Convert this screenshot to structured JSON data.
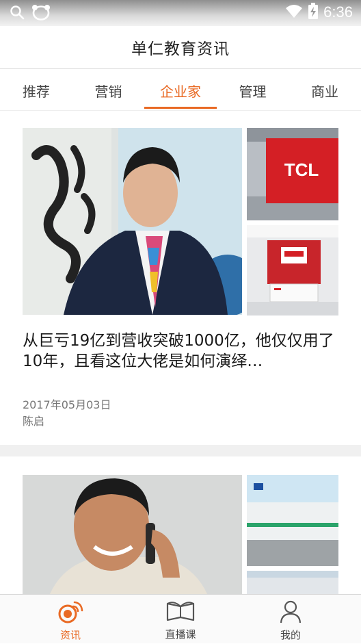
{
  "status_bar": {
    "time": "6:36"
  },
  "app": {
    "title": "单仁教育资讯"
  },
  "tabs": [
    {
      "label": "推荐"
    },
    {
      "label": "营销"
    },
    {
      "label": "企业家"
    },
    {
      "label": "管理"
    },
    {
      "label": "商业"
    }
  ],
  "active_tab": "企业家",
  "articles": [
    {
      "title": "从巨亏19亿到营收突破1000亿，他仅仅用了10年，且看这位大佬是如何演绎…",
      "date": "2017年05月03日",
      "author": "陈启",
      "side_image_top_text": "TCL"
    }
  ],
  "bottom_nav": [
    {
      "label": "资讯",
      "icon": "news-radio-icon"
    },
    {
      "label": "直播课",
      "icon": "open-book-icon"
    },
    {
      "label": "我的",
      "icon": "person-icon"
    }
  ],
  "colors": {
    "accent": "#e96a24"
  }
}
